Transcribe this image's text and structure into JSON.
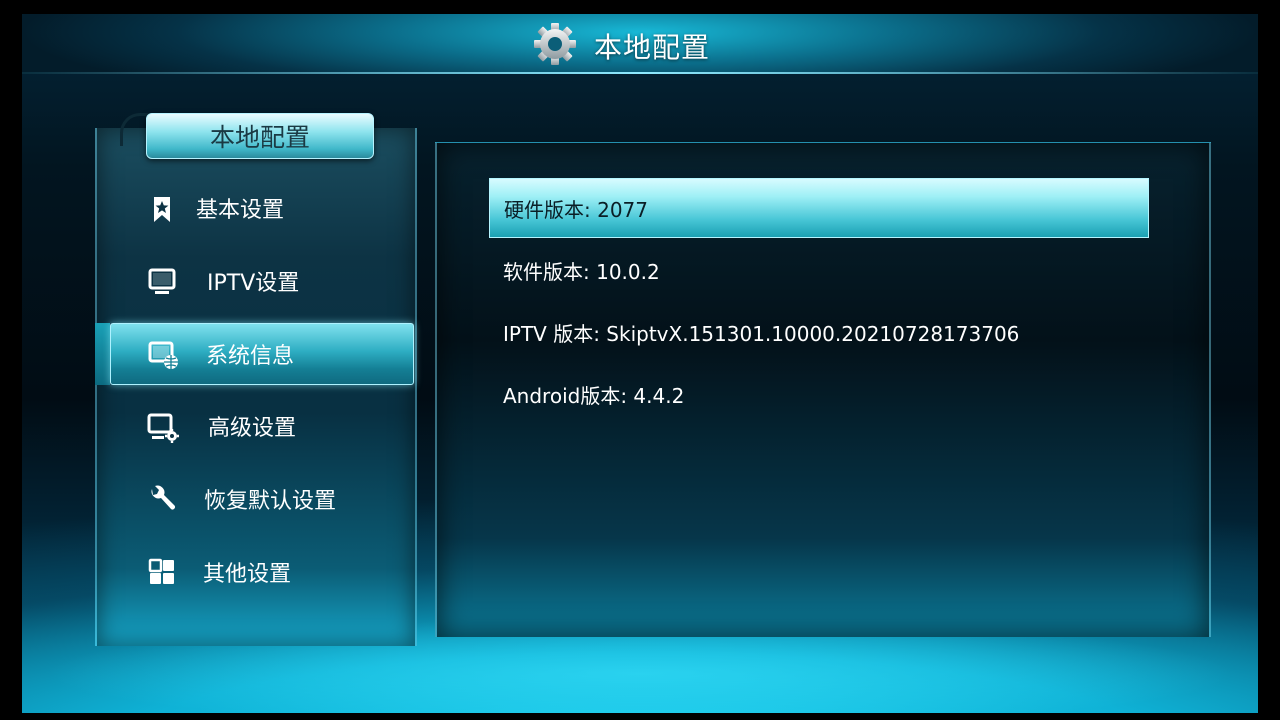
{
  "header": {
    "title": "本地配置",
    "icon": "gear-icon"
  },
  "sidebar": {
    "tab_label": "本地配置",
    "items": [
      {
        "label": "基本设置",
        "icon": "bookmark-star-icon",
        "selected": false
      },
      {
        "label": "IPTV设置",
        "icon": "monitor-icon",
        "selected": false
      },
      {
        "label": "系统信息",
        "icon": "system-info-icon",
        "selected": true
      },
      {
        "label": "高级设置",
        "icon": "monitor-gear-icon",
        "selected": false
      },
      {
        "label": "恢复默认设置",
        "icon": "wrench-icon",
        "selected": false
      },
      {
        "label": "其他设置",
        "icon": "grid-icon",
        "selected": false
      }
    ]
  },
  "info": {
    "rows": [
      {
        "text": "硬件版本: 2077",
        "selected": true
      },
      {
        "text": "软件版本: 10.0.2",
        "selected": false
      },
      {
        "text": "IPTV 版本: SkiptvX.151301.10000.20210728173706",
        "selected": false
      },
      {
        "text": "Android版本: 4.4.2",
        "selected": false
      }
    ]
  },
  "colors": {
    "accent": "#2eaec3",
    "highlight": "#9ff0f6",
    "background": "#010c14"
  }
}
